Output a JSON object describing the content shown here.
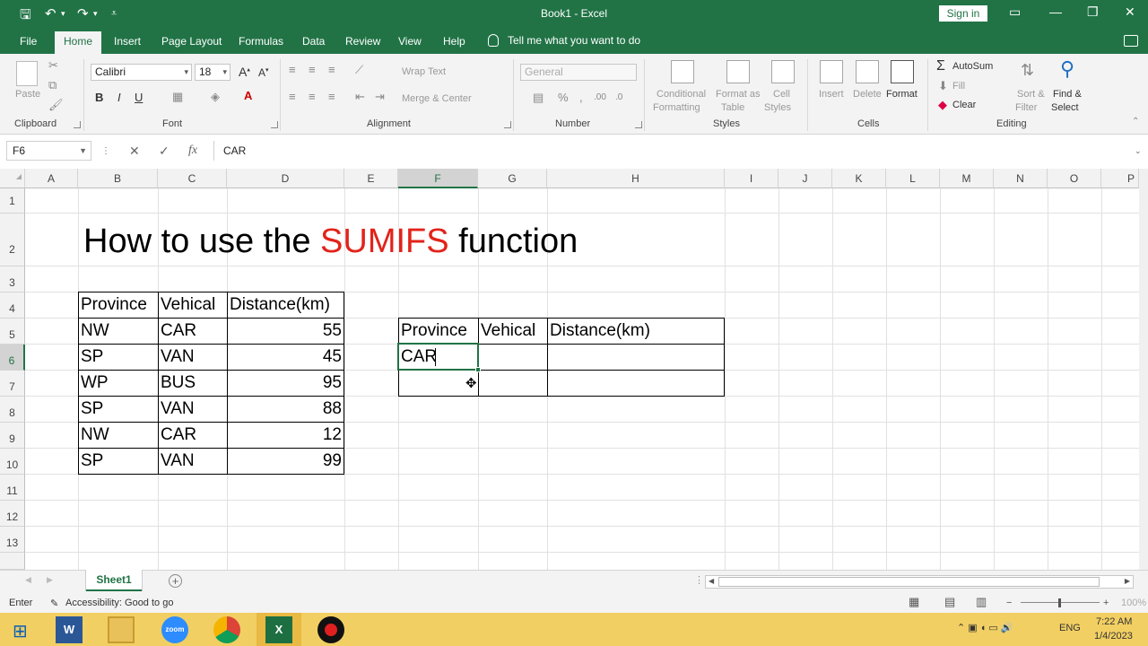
{
  "window": {
    "title": "Book1  -  Excel",
    "sign_in": "Sign in"
  },
  "tabs": [
    "File",
    "Home",
    "Insert",
    "Page Layout",
    "Formulas",
    "Data",
    "Review",
    "View",
    "Help"
  ],
  "tell_me": "Tell me what you want to do",
  "ribbon": {
    "clipboard": {
      "label": "Clipboard",
      "paste": "Paste"
    },
    "font": {
      "label": "Font",
      "font_name": "Calibri",
      "font_size": "18",
      "bold": "B",
      "italic": "I",
      "underline": "U"
    },
    "alignment": {
      "label": "Alignment",
      "wrap_text": "Wrap Text",
      "merge_center": "Merge & Center"
    },
    "number": {
      "label": "Number",
      "format": "General",
      "percent": "%"
    },
    "styles": {
      "label": "Styles",
      "conditional": "Conditional",
      "formatting": "Formatting",
      "format_as": "Format as",
      "table": "Table",
      "cell": "Cell",
      "cell_styles": "Styles"
    },
    "cells": {
      "label": "Cells",
      "insert": "Insert",
      "delete": "Delete",
      "format": "Format"
    },
    "editing": {
      "label": "Editing",
      "autosum": "AutoSum",
      "fill": "Fill",
      "clear": "Clear",
      "sort": "Sort &",
      "filter": "Filter",
      "find": "Find &",
      "select": "Select"
    }
  },
  "formula_bar": {
    "name_box": "F6",
    "cancel": "✕",
    "enter": "✓",
    "fx": "fx",
    "content": "CAR"
  },
  "columns": [
    "A",
    "B",
    "C",
    "D",
    "E",
    "F",
    "G",
    "H",
    "I",
    "J",
    "K",
    "L",
    "M",
    "N",
    "O",
    "P"
  ],
  "rows": [
    "1",
    "2",
    "3",
    "4",
    "5",
    "6",
    "7",
    "8",
    "9",
    "10",
    "11",
    "12",
    "13"
  ],
  "sheet": {
    "title_prefix": "How to use the ",
    "title_highlight": "SUMIFS",
    "title_suffix": " function",
    "table1": {
      "headers": [
        "Province",
        "Vehical",
        "Distance(km)"
      ],
      "rows": [
        [
          "NW",
          "CAR",
          "55"
        ],
        [
          "SP",
          "VAN",
          "45"
        ],
        [
          "WP",
          "BUS",
          "95"
        ],
        [
          "SP",
          "VAN",
          "88"
        ],
        [
          "NW",
          "CAR",
          "12"
        ],
        [
          "SP",
          "VAN",
          "99"
        ]
      ]
    },
    "table2": {
      "headers": [
        "Province",
        "Vehical",
        "Distance(km)"
      ],
      "rows": [
        [
          "CAR",
          "",
          ""
        ],
        [
          "",
          "",
          ""
        ]
      ]
    }
  },
  "sheet_tabs": [
    "Sheet1"
  ],
  "status": {
    "mode": "Enter",
    "accessibility": "Accessibility: Good to go",
    "zoom": "100%"
  },
  "taskbar": {
    "apps": [
      "W",
      "zoom",
      "X"
    ],
    "language": "ENG",
    "time": "7:22 AM",
    "date": "1/4/2023"
  }
}
